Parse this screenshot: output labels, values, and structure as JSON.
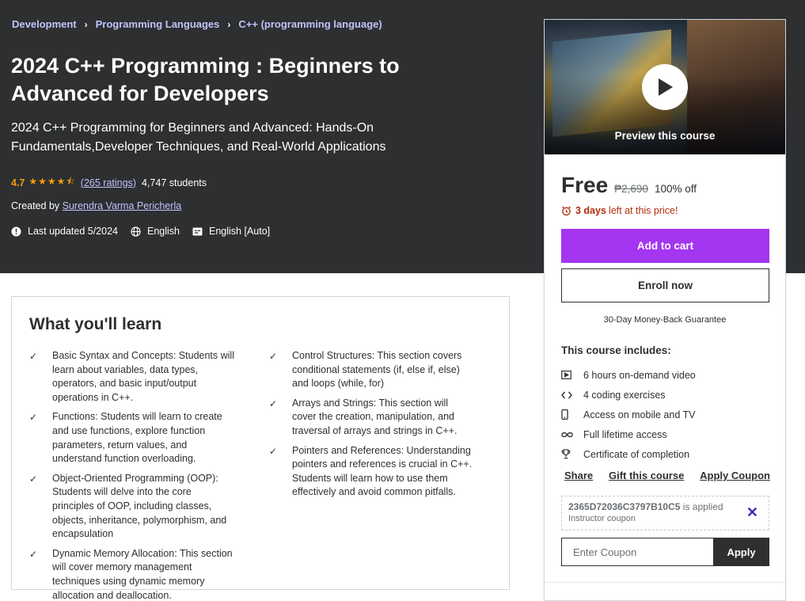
{
  "breadcrumb": [
    "Development",
    "Programming Languages",
    "C++ (programming language)"
  ],
  "course": {
    "title": "2024 C++ Programming : Beginners to Advanced for Developers",
    "subtitle": "2024 C++ Programming for Beginners and Advanced: Hands-On Fundamentals,Developer Techniques, and Real-World Applications",
    "rating": "4.7",
    "stars": "★★★★⯪",
    "ratings_count": "(265 ratings)",
    "students": "4,747 students",
    "created_by_label": "Created by",
    "instructor": "Surendra Varma Pericherla",
    "last_updated": "Last updated 5/2024",
    "language": "English",
    "captions": "English [Auto]"
  },
  "learn": {
    "title": "What you'll learn",
    "check": "✓",
    "left": [
      "Basic Syntax and Concepts: Students will learn about variables, data types, operators, and basic input/output operations in C++.",
      "Functions: Students will learn to create and use functions, explore function parameters, return values, and understand function overloading.",
      "Object-Oriented Programming (OOP): Students will delve into the core principles of OOP, including classes, objects, inheritance, polymorphism, and encapsulation",
      "Dynamic Memory Allocation: This section will cover memory management techniques using dynamic memory allocation and deallocation."
    ],
    "right": [
      "Control Structures: This section covers conditional statements (if, else if, else) and loops (while, for)",
      "Arrays and Strings: This section will cover the creation, manipulation, and traversal of arrays and strings in C++.",
      "Pointers and References: Understanding pointers and references is crucial in C++. Students will learn how to use them effectively and avoid common pitfalls."
    ]
  },
  "sidebar": {
    "preview_label": "Preview this course",
    "price": "Free",
    "original_price": "₱2,690",
    "discount": "100% off",
    "timer_days": "3 days",
    "timer_text": "left at this price!",
    "add_to_cart": "Add to cart",
    "enroll_now": "Enroll now",
    "guarantee": "30-Day Money-Back Guarantee",
    "includes_title": "This course includes:",
    "includes": [
      {
        "icon": "video-icon",
        "label": "6 hours on-demand video"
      },
      {
        "icon": "code-icon",
        "label": "4 coding exercises"
      },
      {
        "icon": "mobile-icon",
        "label": "Access on mobile and TV"
      },
      {
        "icon": "infinity-icon",
        "label": "Full lifetime access"
      },
      {
        "icon": "trophy-icon",
        "label": "Certificate of completion"
      }
    ],
    "share": "Share",
    "gift": "Gift this course",
    "apply_coupon": "Apply Coupon",
    "coupon_code": "2365D72036C3797B10C5",
    "coupon_applied_text": "is applied",
    "coupon_type": "Instructor coupon",
    "coupon_remove": "✕",
    "coupon_placeholder": "Enter Coupon",
    "apply": "Apply"
  },
  "colors": {
    "hero_bg": "#2d2f31",
    "accent_purple": "#a435f0",
    "breadcrumb_link": "#c0c4fc",
    "star": "#f69c08",
    "timer": "#b32d0f"
  }
}
